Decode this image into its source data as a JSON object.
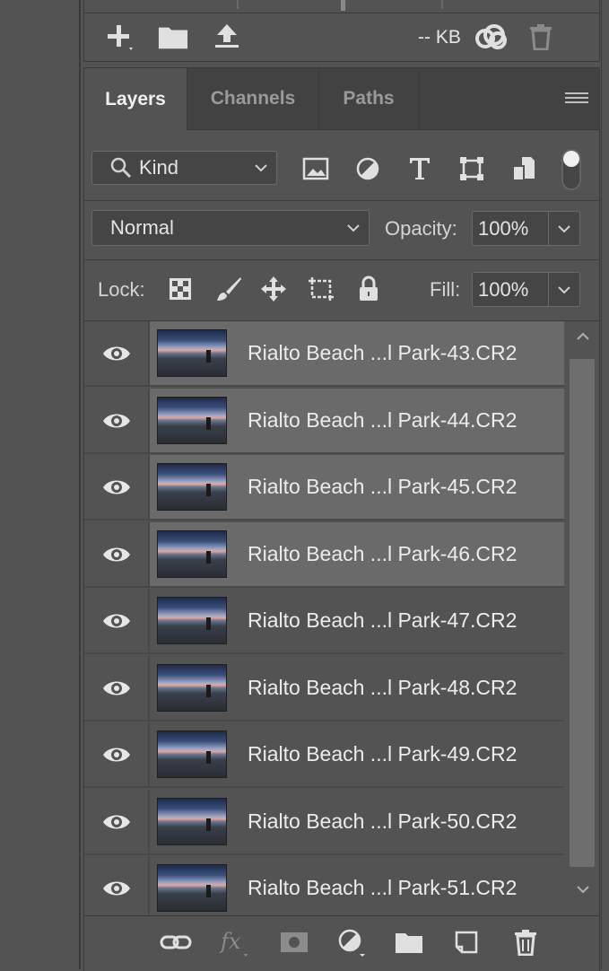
{
  "top_bar": {
    "size_text": "-- KB"
  },
  "tabs": [
    {
      "label": "Layers",
      "active": true
    },
    {
      "label": "Channels",
      "active": false
    },
    {
      "label": "Paths",
      "active": false
    }
  ],
  "filter": {
    "kind_label": "Kind"
  },
  "blend": {
    "mode": "Normal",
    "opacity_label": "Opacity:",
    "opacity_value": "100%"
  },
  "lock": {
    "label": "Lock:",
    "fill_label": "Fill:",
    "fill_value": "100%"
  },
  "layers": [
    {
      "name": "Rialto Beach ...l Park-43.CR2",
      "selected": true
    },
    {
      "name": "Rialto Beach ...l Park-44.CR2",
      "selected": true
    },
    {
      "name": "Rialto Beach ...l Park-45.CR2",
      "selected": true
    },
    {
      "name": "Rialto Beach ...l Park-46.CR2",
      "selected": true
    },
    {
      "name": "Rialto Beach ...l Park-47.CR2",
      "selected": false
    },
    {
      "name": "Rialto Beach ...l Park-48.CR2",
      "selected": false
    },
    {
      "name": "Rialto Beach ...l Park-49.CR2",
      "selected": false
    },
    {
      "name": "Rialto Beach ...l Park-50.CR2",
      "selected": false
    },
    {
      "name": "Rialto Beach ...l Park-51.CR2",
      "selected": false
    }
  ],
  "colors": {
    "panel": "#535353",
    "tabbar": "#424242",
    "selected_row": "#6a6a6a"
  },
  "icons": {
    "top": [
      "plus-icon",
      "folder-icon",
      "upload-icon",
      "creative-cloud-icon",
      "trash-icon"
    ],
    "filter": [
      "image-filter-icon",
      "adjustment-filter-icon",
      "type-filter-icon",
      "shape-filter-icon",
      "smart-object-filter-icon",
      "filter-toggle-icon"
    ],
    "lock": [
      "lock-transparent-icon",
      "lock-paint-icon",
      "lock-move-icon",
      "lock-artboard-icon",
      "lock-all-icon"
    ],
    "footer": [
      "link-icon",
      "fx-icon",
      "mask-icon",
      "adjustment-layer-icon",
      "group-icon",
      "new-layer-icon",
      "delete-icon"
    ]
  }
}
